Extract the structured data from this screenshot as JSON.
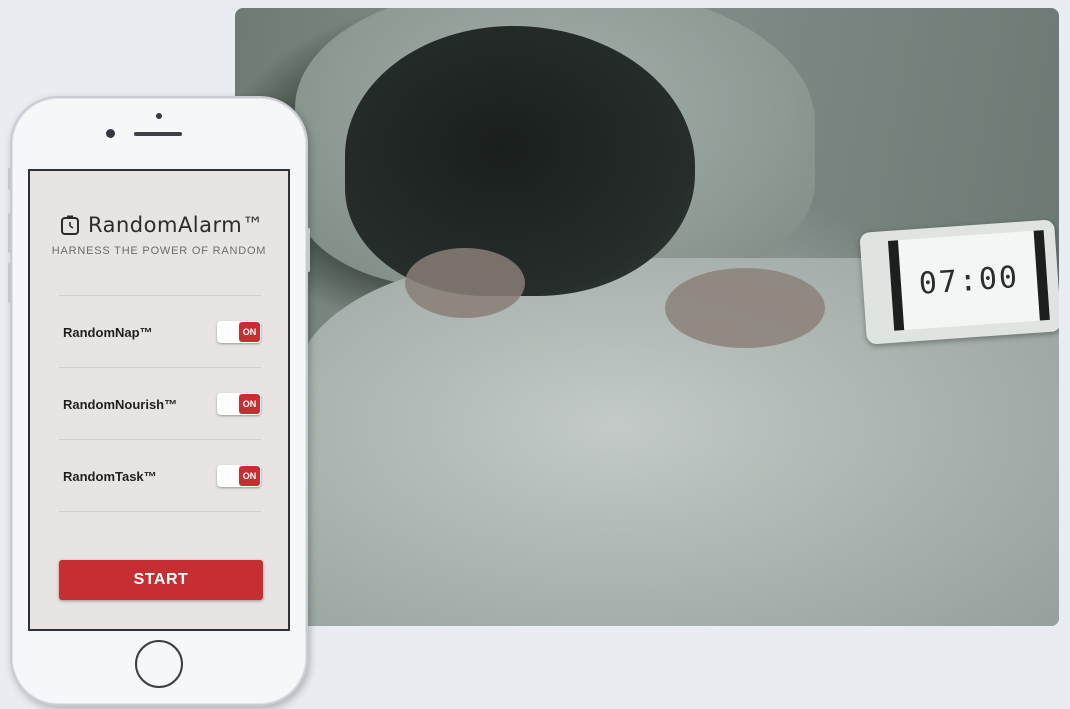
{
  "photo": {
    "clock_time": "07:00"
  },
  "app": {
    "title": "RandomAlarm™",
    "subtitle": "HARNESS THE POWER OF RANDOM",
    "settings": [
      {
        "label": "RandomNap™",
        "state": "ON"
      },
      {
        "label": "RandomNourish™",
        "state": "ON"
      },
      {
        "label": "RandomTask™",
        "state": "ON"
      }
    ],
    "start_label": "START"
  },
  "colors": {
    "accent": "#c62f32",
    "screen_bg": "#e7e4e1",
    "page_bg": "#e9edf2"
  },
  "icons": {
    "logo": "clock-icon"
  }
}
